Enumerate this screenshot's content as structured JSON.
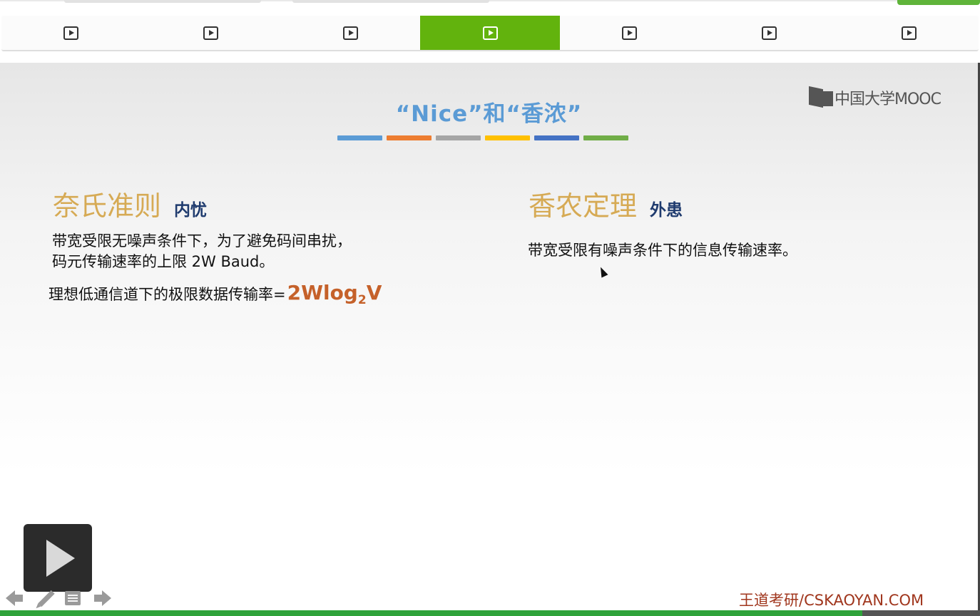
{
  "unit_tabs": {
    "items": [
      {
        "icon": "play-icon",
        "active": false
      },
      {
        "icon": "play-icon",
        "active": false
      },
      {
        "icon": "play-icon",
        "active": false
      },
      {
        "icon": "play-icon",
        "active": true
      },
      {
        "icon": "play-icon",
        "active": false
      },
      {
        "icon": "play-icon",
        "active": false
      },
      {
        "icon": "play-icon",
        "active": false
      }
    ],
    "active_color": "#62b30d"
  },
  "slide": {
    "logo_text": "中国大学MOOC",
    "title": "“Nice”和“香浓”",
    "title_color": "#5b9bd5",
    "accent_bar_colors": [
      "#5b9bd5",
      "#ed7d31",
      "#a5a5a5",
      "#ffc000",
      "#4472c4",
      "#70ad47"
    ],
    "left": {
      "heading": "奈氏准则",
      "subheading": "内忧",
      "para_line1": "带宽受限无噪声条件下，为了避免码间串扰，",
      "para_line2": "码元传输速率的上限 2W Baud。",
      "formula_label": "理想低通信道下的极限数据传输率=",
      "formula_main": "2Wlog",
      "formula_sub": "2",
      "formula_end": "V"
    },
    "right": {
      "heading": "香农定理",
      "subheading": "外患",
      "para": "带宽受限有噪声条件下的信息传输速率。"
    },
    "footer_credit": "王道考研/CSKAOYAN.COM"
  },
  "player": {
    "big_play_icon": "play-icon",
    "controls": [
      "prev-arrow-icon",
      "pen-icon",
      "notes-icon",
      "next-arrow-icon"
    ],
    "progress_fraction": 0.88,
    "progress_color": "#2ea33a"
  }
}
